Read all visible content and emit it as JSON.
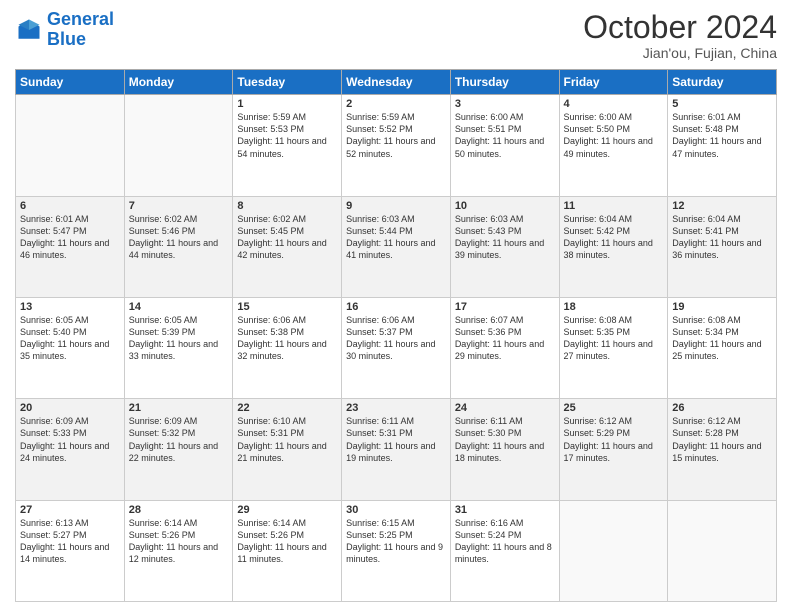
{
  "header": {
    "logo_general": "General",
    "logo_blue": "Blue",
    "month_title": "October 2024",
    "location": "Jian'ou, Fujian, China"
  },
  "days_of_week": [
    "Sunday",
    "Monday",
    "Tuesday",
    "Wednesday",
    "Thursday",
    "Friday",
    "Saturday"
  ],
  "weeks": [
    [
      {
        "day": "",
        "sunrise": "",
        "sunset": "",
        "daylight": ""
      },
      {
        "day": "",
        "sunrise": "",
        "sunset": "",
        "daylight": ""
      },
      {
        "day": "1",
        "sunrise": "Sunrise: 5:59 AM",
        "sunset": "Sunset: 5:53 PM",
        "daylight": "Daylight: 11 hours and 54 minutes."
      },
      {
        "day": "2",
        "sunrise": "Sunrise: 5:59 AM",
        "sunset": "Sunset: 5:52 PM",
        "daylight": "Daylight: 11 hours and 52 minutes."
      },
      {
        "day": "3",
        "sunrise": "Sunrise: 6:00 AM",
        "sunset": "Sunset: 5:51 PM",
        "daylight": "Daylight: 11 hours and 50 minutes."
      },
      {
        "day": "4",
        "sunrise": "Sunrise: 6:00 AM",
        "sunset": "Sunset: 5:50 PM",
        "daylight": "Daylight: 11 hours and 49 minutes."
      },
      {
        "day": "5",
        "sunrise": "Sunrise: 6:01 AM",
        "sunset": "Sunset: 5:48 PM",
        "daylight": "Daylight: 11 hours and 47 minutes."
      }
    ],
    [
      {
        "day": "6",
        "sunrise": "Sunrise: 6:01 AM",
        "sunset": "Sunset: 5:47 PM",
        "daylight": "Daylight: 11 hours and 46 minutes."
      },
      {
        "day": "7",
        "sunrise": "Sunrise: 6:02 AM",
        "sunset": "Sunset: 5:46 PM",
        "daylight": "Daylight: 11 hours and 44 minutes."
      },
      {
        "day": "8",
        "sunrise": "Sunrise: 6:02 AM",
        "sunset": "Sunset: 5:45 PM",
        "daylight": "Daylight: 11 hours and 42 minutes."
      },
      {
        "day": "9",
        "sunrise": "Sunrise: 6:03 AM",
        "sunset": "Sunset: 5:44 PM",
        "daylight": "Daylight: 11 hours and 41 minutes."
      },
      {
        "day": "10",
        "sunrise": "Sunrise: 6:03 AM",
        "sunset": "Sunset: 5:43 PM",
        "daylight": "Daylight: 11 hours and 39 minutes."
      },
      {
        "day": "11",
        "sunrise": "Sunrise: 6:04 AM",
        "sunset": "Sunset: 5:42 PM",
        "daylight": "Daylight: 11 hours and 38 minutes."
      },
      {
        "day": "12",
        "sunrise": "Sunrise: 6:04 AM",
        "sunset": "Sunset: 5:41 PM",
        "daylight": "Daylight: 11 hours and 36 minutes."
      }
    ],
    [
      {
        "day": "13",
        "sunrise": "Sunrise: 6:05 AM",
        "sunset": "Sunset: 5:40 PM",
        "daylight": "Daylight: 11 hours and 35 minutes."
      },
      {
        "day": "14",
        "sunrise": "Sunrise: 6:05 AM",
        "sunset": "Sunset: 5:39 PM",
        "daylight": "Daylight: 11 hours and 33 minutes."
      },
      {
        "day": "15",
        "sunrise": "Sunrise: 6:06 AM",
        "sunset": "Sunset: 5:38 PM",
        "daylight": "Daylight: 11 hours and 32 minutes."
      },
      {
        "day": "16",
        "sunrise": "Sunrise: 6:06 AM",
        "sunset": "Sunset: 5:37 PM",
        "daylight": "Daylight: 11 hours and 30 minutes."
      },
      {
        "day": "17",
        "sunrise": "Sunrise: 6:07 AM",
        "sunset": "Sunset: 5:36 PM",
        "daylight": "Daylight: 11 hours and 29 minutes."
      },
      {
        "day": "18",
        "sunrise": "Sunrise: 6:08 AM",
        "sunset": "Sunset: 5:35 PM",
        "daylight": "Daylight: 11 hours and 27 minutes."
      },
      {
        "day": "19",
        "sunrise": "Sunrise: 6:08 AM",
        "sunset": "Sunset: 5:34 PM",
        "daylight": "Daylight: 11 hours and 25 minutes."
      }
    ],
    [
      {
        "day": "20",
        "sunrise": "Sunrise: 6:09 AM",
        "sunset": "Sunset: 5:33 PM",
        "daylight": "Daylight: 11 hours and 24 minutes."
      },
      {
        "day": "21",
        "sunrise": "Sunrise: 6:09 AM",
        "sunset": "Sunset: 5:32 PM",
        "daylight": "Daylight: 11 hours and 22 minutes."
      },
      {
        "day": "22",
        "sunrise": "Sunrise: 6:10 AM",
        "sunset": "Sunset: 5:31 PM",
        "daylight": "Daylight: 11 hours and 21 minutes."
      },
      {
        "day": "23",
        "sunrise": "Sunrise: 6:11 AM",
        "sunset": "Sunset: 5:31 PM",
        "daylight": "Daylight: 11 hours and 19 minutes."
      },
      {
        "day": "24",
        "sunrise": "Sunrise: 6:11 AM",
        "sunset": "Sunset: 5:30 PM",
        "daylight": "Daylight: 11 hours and 18 minutes."
      },
      {
        "day": "25",
        "sunrise": "Sunrise: 6:12 AM",
        "sunset": "Sunset: 5:29 PM",
        "daylight": "Daylight: 11 hours and 17 minutes."
      },
      {
        "day": "26",
        "sunrise": "Sunrise: 6:12 AM",
        "sunset": "Sunset: 5:28 PM",
        "daylight": "Daylight: 11 hours and 15 minutes."
      }
    ],
    [
      {
        "day": "27",
        "sunrise": "Sunrise: 6:13 AM",
        "sunset": "Sunset: 5:27 PM",
        "daylight": "Daylight: 11 hours and 14 minutes."
      },
      {
        "day": "28",
        "sunrise": "Sunrise: 6:14 AM",
        "sunset": "Sunset: 5:26 PM",
        "daylight": "Daylight: 11 hours and 12 minutes."
      },
      {
        "day": "29",
        "sunrise": "Sunrise: 6:14 AM",
        "sunset": "Sunset: 5:26 PM",
        "daylight": "Daylight: 11 hours and 11 minutes."
      },
      {
        "day": "30",
        "sunrise": "Sunrise: 6:15 AM",
        "sunset": "Sunset: 5:25 PM",
        "daylight": "Daylight: 11 hours and 9 minutes."
      },
      {
        "day": "31",
        "sunrise": "Sunrise: 6:16 AM",
        "sunset": "Sunset: 5:24 PM",
        "daylight": "Daylight: 11 hours and 8 minutes."
      },
      {
        "day": "",
        "sunrise": "",
        "sunset": "",
        "daylight": ""
      },
      {
        "day": "",
        "sunrise": "",
        "sunset": "",
        "daylight": ""
      }
    ]
  ]
}
